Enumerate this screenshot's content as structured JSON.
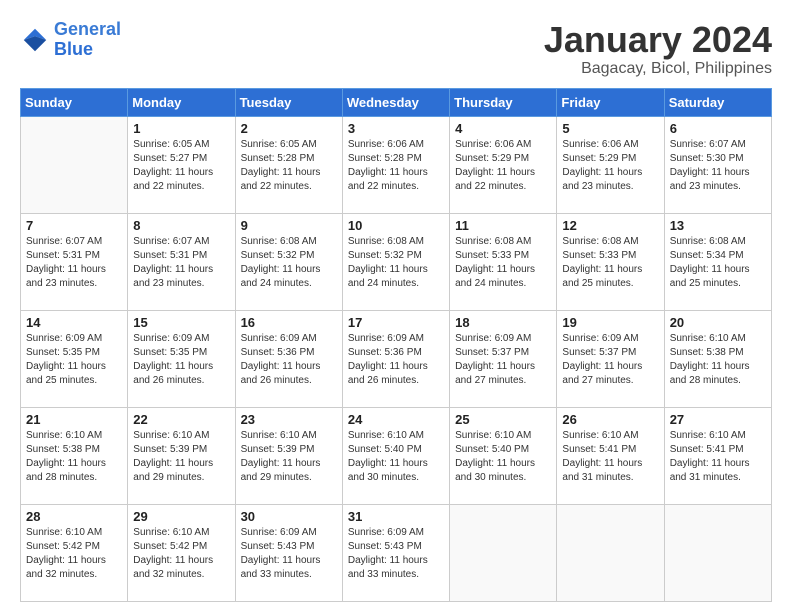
{
  "header": {
    "logo_general": "General",
    "logo_blue": "Blue",
    "month": "January 2024",
    "location": "Bagacay, Bicol, Philippines"
  },
  "days_of_week": [
    "Sunday",
    "Monday",
    "Tuesday",
    "Wednesday",
    "Thursday",
    "Friday",
    "Saturday"
  ],
  "weeks": [
    [
      {
        "num": "",
        "info": ""
      },
      {
        "num": "1",
        "info": "Sunrise: 6:05 AM\nSunset: 5:27 PM\nDaylight: 11 hours\nand 22 minutes."
      },
      {
        "num": "2",
        "info": "Sunrise: 6:05 AM\nSunset: 5:28 PM\nDaylight: 11 hours\nand 22 minutes."
      },
      {
        "num": "3",
        "info": "Sunrise: 6:06 AM\nSunset: 5:28 PM\nDaylight: 11 hours\nand 22 minutes."
      },
      {
        "num": "4",
        "info": "Sunrise: 6:06 AM\nSunset: 5:29 PM\nDaylight: 11 hours\nand 22 minutes."
      },
      {
        "num": "5",
        "info": "Sunrise: 6:06 AM\nSunset: 5:29 PM\nDaylight: 11 hours\nand 23 minutes."
      },
      {
        "num": "6",
        "info": "Sunrise: 6:07 AM\nSunset: 5:30 PM\nDaylight: 11 hours\nand 23 minutes."
      }
    ],
    [
      {
        "num": "7",
        "info": "Sunrise: 6:07 AM\nSunset: 5:31 PM\nDaylight: 11 hours\nand 23 minutes."
      },
      {
        "num": "8",
        "info": "Sunrise: 6:07 AM\nSunset: 5:31 PM\nDaylight: 11 hours\nand 23 minutes."
      },
      {
        "num": "9",
        "info": "Sunrise: 6:08 AM\nSunset: 5:32 PM\nDaylight: 11 hours\nand 24 minutes."
      },
      {
        "num": "10",
        "info": "Sunrise: 6:08 AM\nSunset: 5:32 PM\nDaylight: 11 hours\nand 24 minutes."
      },
      {
        "num": "11",
        "info": "Sunrise: 6:08 AM\nSunset: 5:33 PM\nDaylight: 11 hours\nand 24 minutes."
      },
      {
        "num": "12",
        "info": "Sunrise: 6:08 AM\nSunset: 5:33 PM\nDaylight: 11 hours\nand 25 minutes."
      },
      {
        "num": "13",
        "info": "Sunrise: 6:08 AM\nSunset: 5:34 PM\nDaylight: 11 hours\nand 25 minutes."
      }
    ],
    [
      {
        "num": "14",
        "info": "Sunrise: 6:09 AM\nSunset: 5:35 PM\nDaylight: 11 hours\nand 25 minutes."
      },
      {
        "num": "15",
        "info": "Sunrise: 6:09 AM\nSunset: 5:35 PM\nDaylight: 11 hours\nand 26 minutes."
      },
      {
        "num": "16",
        "info": "Sunrise: 6:09 AM\nSunset: 5:36 PM\nDaylight: 11 hours\nand 26 minutes."
      },
      {
        "num": "17",
        "info": "Sunrise: 6:09 AM\nSunset: 5:36 PM\nDaylight: 11 hours\nand 26 minutes."
      },
      {
        "num": "18",
        "info": "Sunrise: 6:09 AM\nSunset: 5:37 PM\nDaylight: 11 hours\nand 27 minutes."
      },
      {
        "num": "19",
        "info": "Sunrise: 6:09 AM\nSunset: 5:37 PM\nDaylight: 11 hours\nand 27 minutes."
      },
      {
        "num": "20",
        "info": "Sunrise: 6:10 AM\nSunset: 5:38 PM\nDaylight: 11 hours\nand 28 minutes."
      }
    ],
    [
      {
        "num": "21",
        "info": "Sunrise: 6:10 AM\nSunset: 5:38 PM\nDaylight: 11 hours\nand 28 minutes."
      },
      {
        "num": "22",
        "info": "Sunrise: 6:10 AM\nSunset: 5:39 PM\nDaylight: 11 hours\nand 29 minutes."
      },
      {
        "num": "23",
        "info": "Sunrise: 6:10 AM\nSunset: 5:39 PM\nDaylight: 11 hours\nand 29 minutes."
      },
      {
        "num": "24",
        "info": "Sunrise: 6:10 AM\nSunset: 5:40 PM\nDaylight: 11 hours\nand 30 minutes."
      },
      {
        "num": "25",
        "info": "Sunrise: 6:10 AM\nSunset: 5:40 PM\nDaylight: 11 hours\nand 30 minutes."
      },
      {
        "num": "26",
        "info": "Sunrise: 6:10 AM\nSunset: 5:41 PM\nDaylight: 11 hours\nand 31 minutes."
      },
      {
        "num": "27",
        "info": "Sunrise: 6:10 AM\nSunset: 5:41 PM\nDaylight: 11 hours\nand 31 minutes."
      }
    ],
    [
      {
        "num": "28",
        "info": "Sunrise: 6:10 AM\nSunset: 5:42 PM\nDaylight: 11 hours\nand 32 minutes."
      },
      {
        "num": "29",
        "info": "Sunrise: 6:10 AM\nSunset: 5:42 PM\nDaylight: 11 hours\nand 32 minutes."
      },
      {
        "num": "30",
        "info": "Sunrise: 6:09 AM\nSunset: 5:43 PM\nDaylight: 11 hours\nand 33 minutes."
      },
      {
        "num": "31",
        "info": "Sunrise: 6:09 AM\nSunset: 5:43 PM\nDaylight: 11 hours\nand 33 minutes."
      },
      {
        "num": "",
        "info": ""
      },
      {
        "num": "",
        "info": ""
      },
      {
        "num": "",
        "info": ""
      }
    ]
  ]
}
